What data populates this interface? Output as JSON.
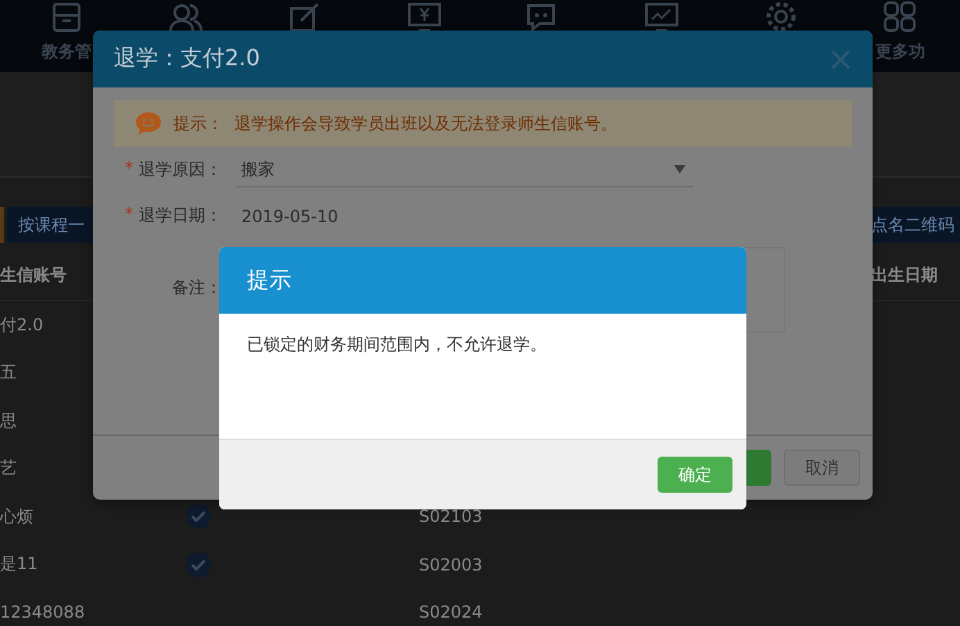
{
  "nav": {
    "items": [
      {
        "kind": "archive",
        "label": "教务管"
      },
      {
        "kind": "people"
      },
      {
        "kind": "edit"
      },
      {
        "kind": "monitor"
      },
      {
        "kind": "chat"
      },
      {
        "kind": "chart"
      },
      {
        "kind": "gear"
      },
      {
        "kind": "grid",
        "label": "更多功"
      }
    ]
  },
  "toolbar": {
    "left_button": "按课程一",
    "right_button": "点名二维码"
  },
  "table": {
    "columns": [
      {
        "label": "生信账号"
      },
      {
        "label": "出生日期"
      }
    ],
    "rows": [
      {
        "column_1": "付2.0"
      },
      {
        "column_1": "五"
      },
      {
        "column_1": "思"
      },
      {
        "column_1": "艺"
      },
      {
        "column_1": "心烦",
        "checked": true,
        "code": "S02103"
      },
      {
        "column_1": "是11",
        "checked": true,
        "code": "S02003"
      },
      {
        "column_1": "12348088",
        "checked": false,
        "code": "S02024"
      }
    ]
  },
  "modal": {
    "title": "退学：支付2.0",
    "tip": {
      "label": "提示：",
      "text": "退学操作会导致学员出班以及无法登录师生信账号。"
    },
    "fields": [
      {
        "kind": "select",
        "required_mark": "*",
        "label": "退学原因：",
        "value": "搬家"
      },
      {
        "kind": "text",
        "required_mark": "*",
        "label": "退学日期：",
        "value": "2019-05-10"
      },
      {
        "kind": "textarea",
        "label": "备注："
      }
    ],
    "buttons": [
      {
        "kind": "primary"
      },
      {
        "kind": "default",
        "label": "取消"
      }
    ]
  },
  "alert": {
    "title": "提示",
    "message": "已锁定的财务期间范围内，不允许退学。",
    "buttons": [
      {
        "kind": "primary",
        "label": "确定"
      }
    ]
  }
}
